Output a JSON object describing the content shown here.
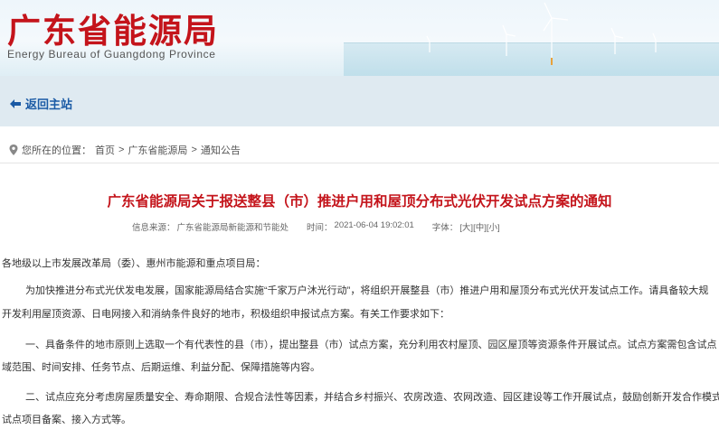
{
  "header": {
    "title": "广东省能源局",
    "subtitle": "Energy Bureau of Guangdong Province"
  },
  "nav": {
    "back_label": "返回主站"
  },
  "breadcrumb": {
    "prefix": "您所在的位置：",
    "items": [
      "首页",
      "广东省能源局",
      "通知公告"
    ],
    "separator": ">"
  },
  "article": {
    "title": "广东省能源局关于报送整县（市）推进户用和屋顶分布式光伏开发试点方案的通知",
    "meta": {
      "source_label": "信息来源：",
      "source": "广东省能源局新能源和节能处",
      "time_label": "时间：",
      "time": "2021-06-04 19:02:01",
      "font_label": "字体：",
      "font_large": "[大]",
      "font_medium": "[中]",
      "font_small": "[小]"
    },
    "lines": [
      "各地级以上市发展改革局（委）、惠州市能源和重点项目局：",
      "为加快推进分布式光伏发电发展，国家能源局结合实施“千家万户沐光行动”，将组织开展整县（市）推进户用和屋顶分布式光伏开发试点工作。请具备较大规",
      "开发利用屋顶资源、日电网接入和消纳条件良好的地市，积极组织申报试点方案。有关工作要求如下：",
      "一、具备条件的地市原则上选取一个有代表性的县（市），提出整县（市）试点方案，充分利用农村屋顶、园区屋顶等资源条件开展试点。试点方案需包含试点",
      "域范围、时间安排、任务节点、后期运维、利益分配、保障措施等内容。",
      "二、试点应充分考虑房屋质量安全、寿命期限、合规合法性等因素，并结合乡村振兴、农房改造、农网改造、园区建设等工作开展试点，鼓励创新开发合作模式",
      "试点项目备案、接入方式等。"
    ]
  }
}
